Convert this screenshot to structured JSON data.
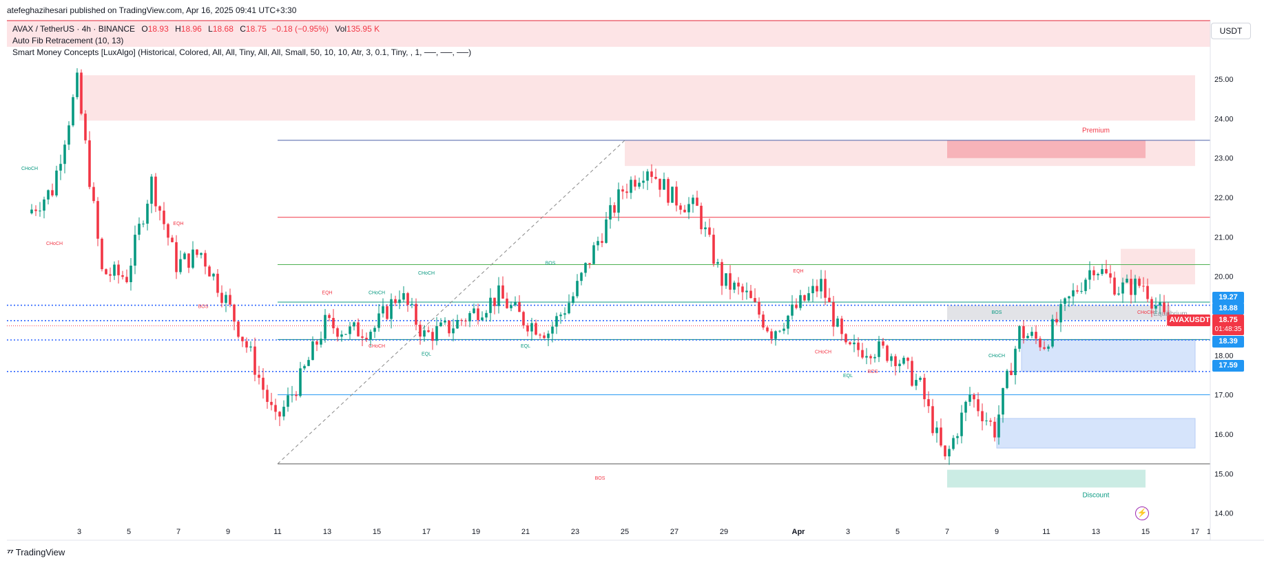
{
  "header": {
    "publisher": "atefeghazihesari published on TradingView.com, Apr 16, 2025 09:41 UTC+3:30"
  },
  "legend": {
    "symbol": "AVAX / TetherUS · 4h · BINANCE",
    "o_label": "O",
    "o_value": "18.93",
    "h_label": "H",
    "h_value": "18.96",
    "l_label": "L",
    "l_value": "18.68",
    "c_label": "C",
    "c_value": "18.75",
    "change": "−0.18 (−0.95%)",
    "vol_label": "Vol",
    "vol_value": "135.95 K",
    "indicator1": "Auto Fib Retracement (10, 13)",
    "indicator2": "Smart Money Concepts [LuxAlgo] (Historical, Colored, All, All, Tiny, All, All, Small, 50, 10, 10, Atr, 3, 0.1, Tiny, , 1, ──, ──, ──)"
  },
  "currency": "USDT",
  "price_tags": {
    "t1": "19.27",
    "t2": "18.88",
    "t3_symbol": "AVAXUSDT",
    "t3_price": "18.75",
    "t3_timer": "01:48:35",
    "t4": "18.39",
    "t5": "17.59"
  },
  "brand": {
    "name": "TradingView"
  },
  "colors": {
    "up": "#089981",
    "down": "#f23645",
    "blue_tag": "#2196f3",
    "accent": "#2962ff"
  },
  "chart_data": {
    "type": "candlestick",
    "title": "AVAX / TetherUS · 4h · BINANCE",
    "y_axis": {
      "ticks": [
        "25.00",
        "24.00",
        "23.00",
        "22.00",
        "21.00",
        "20.00",
        "19.00",
        "18.00",
        "17.00",
        "16.00",
        "15.00",
        "14.00"
      ],
      "range": [
        13.75,
        25.35
      ]
    },
    "x_axis": {
      "ticks": [
        "3",
        "5",
        "7",
        "9",
        "11",
        "13",
        "15",
        "17",
        "19",
        "21",
        "23",
        "25",
        "27",
        "29",
        "Apr",
        "3",
        "5",
        "7",
        "9",
        "11",
        "13",
        "15",
        "17",
        "1"
      ],
      "range": [
        "2025-03-01",
        "2025-04-17"
      ]
    },
    "close_path": [
      {
        "t": "2025-03-01",
        "p": 21.6
      },
      {
        "t": "2025-03-02",
        "p": 22.2
      },
      {
        "t": "2025-03-03",
        "p": 24.9
      },
      {
        "t": "2025-03-04",
        "p": 20.1
      },
      {
        "t": "2025-03-05",
        "p": 20.0
      },
      {
        "t": "2025-03-06",
        "p": 22.4
      },
      {
        "t": "2025-03-07",
        "p": 20.3
      },
      {
        "t": "2025-03-08",
        "p": 20.6
      },
      {
        "t": "2025-03-09",
        "p": 19.4
      },
      {
        "t": "2025-03-10",
        "p": 18.0
      },
      {
        "t": "2025-03-11",
        "p": 16.3
      },
      {
        "t": "2025-03-12",
        "p": 17.4
      },
      {
        "t": "2025-03-13",
        "p": 18.8
      },
      {
        "t": "2025-03-14",
        "p": 18.6
      },
      {
        "t": "2025-03-15",
        "p": 18.7
      },
      {
        "t": "2025-03-16",
        "p": 19.6
      },
      {
        "t": "2025-03-17",
        "p": 18.5
      },
      {
        "t": "2025-03-18",
        "p": 18.7
      },
      {
        "t": "2025-03-19",
        "p": 19.1
      },
      {
        "t": "2025-03-20",
        "p": 19.5
      },
      {
        "t": "2025-03-21",
        "p": 18.9
      },
      {
        "t": "2025-03-22",
        "p": 18.6
      },
      {
        "t": "2025-03-23",
        "p": 19.5
      },
      {
        "t": "2025-03-24",
        "p": 20.9
      },
      {
        "t": "2025-03-25",
        "p": 22.2
      },
      {
        "t": "2025-03-26",
        "p": 22.8
      },
      {
        "t": "2025-03-27",
        "p": 22.0
      },
      {
        "t": "2025-03-28",
        "p": 21.7
      },
      {
        "t": "2025-03-29",
        "p": 19.9
      },
      {
        "t": "2025-03-30",
        "p": 19.5
      },
      {
        "t": "2025-03-31",
        "p": 18.6
      },
      {
        "t": "2025-04-01",
        "p": 19.2
      },
      {
        "t": "2025-04-02",
        "p": 19.8
      },
      {
        "t": "2025-04-03",
        "p": 18.1
      },
      {
        "t": "2025-04-04",
        "p": 18.2
      },
      {
        "t": "2025-04-05",
        "p": 18.0
      },
      {
        "t": "2025-04-06",
        "p": 17.2
      },
      {
        "t": "2025-04-07",
        "p": 15.3
      },
      {
        "t": "2025-04-08",
        "p": 17.0
      },
      {
        "t": "2025-04-09",
        "p": 16.1
      },
      {
        "t": "2025-04-10",
        "p": 18.6
      },
      {
        "t": "2025-04-11",
        "p": 18.3
      },
      {
        "t": "2025-04-12",
        "p": 19.4
      },
      {
        "t": "2025-04-13",
        "p": 20.3
      },
      {
        "t": "2025-04-14",
        "p": 19.7
      },
      {
        "t": "2025-04-15",
        "p": 19.8
      },
      {
        "t": "2025-04-16",
        "p": 18.75
      }
    ],
    "zones": [
      {
        "type": "supply",
        "from": "2025-03-03",
        "to": "2025-04-17",
        "low": 23.95,
        "high": 25.1
      },
      {
        "type": "supply",
        "from": "2025-03-25",
        "to": "2025-04-17",
        "low": 22.8,
        "high": 23.45
      },
      {
        "type": "supply-strong",
        "from": "2025-04-07",
        "to": "2025-04-15",
        "low": 23.0,
        "high": 23.45
      },
      {
        "type": "supply",
        "from": "2025-04-14",
        "to": "2025-04-17",
        "low": 19.8,
        "high": 20.7
      },
      {
        "type": "equilibrium",
        "from": "2025-04-07",
        "to": "2025-04-16",
        "low": 18.9,
        "high": 19.27
      },
      {
        "type": "demand",
        "from": "2025-04-10",
        "to": "2025-04-17",
        "low": 17.59,
        "high": 18.39
      },
      {
        "type": "demand",
        "from": "2025-04-09",
        "to": "2025-04-17",
        "low": 15.65,
        "high": 16.4
      },
      {
        "type": "discount",
        "from": "2025-04-07",
        "to": "2025-04-15",
        "low": 14.65,
        "high": 15.1
      }
    ],
    "levels": [
      {
        "name": "fib-top",
        "price": 23.45,
        "color": "#4a5fa8"
      },
      {
        "name": "fib-1",
        "price": 21.5,
        "color": "#f23645"
      },
      {
        "name": "fib-2",
        "price": 20.3,
        "color": "#4caf50"
      },
      {
        "name": "fib-3",
        "price": 19.35,
        "color": "#089981"
      },
      {
        "name": "fib-4",
        "price": 18.4,
        "color": "#00897b"
      },
      {
        "name": "fib-5",
        "price": 17.0,
        "color": "#2196f3"
      },
      {
        "name": "fib-bottom",
        "price": 15.25,
        "color": "#555555"
      }
    ],
    "dotted_levels": [
      19.27,
      18.88,
      18.39,
      17.59
    ],
    "labels": [
      {
        "text": "Premium",
        "t": "2025-04-13",
        "p": 23.65,
        "color": "#f23645"
      },
      {
        "text": "Discount",
        "t": "2025-04-13",
        "p": 14.4,
        "color": "#089981"
      },
      {
        "text": "Equilibrium",
        "t": "2025-04-16",
        "p": 19.0,
        "color": "#9598a1"
      },
      {
        "text": "BOS",
        "t": "2025-03-24",
        "p": 14.85,
        "color": "#f23645"
      },
      {
        "text": "BOS",
        "t": "2025-03-22",
        "p": 20.3,
        "color": "#089981"
      },
      {
        "text": "BOS",
        "t": "2025-04-09",
        "p": 19.05,
        "color": "#089981"
      },
      {
        "text": "BOS",
        "t": "2025-04-04",
        "p": 17.55,
        "color": "#f23645"
      },
      {
        "text": "BOS",
        "t": "2025-03-08",
        "p": 19.2,
        "color": "#f23645"
      },
      {
        "text": "CHoCH",
        "t": "2025-03-01",
        "p": 22.7,
        "color": "#089981"
      },
      {
        "text": "CHoCH",
        "t": "2025-03-02",
        "p": 20.8,
        "color": "#f23645"
      },
      {
        "text": "CHoCH",
        "t": "2025-03-17",
        "p": 20.05,
        "color": "#089981"
      },
      {
        "text": "CHoCH",
        "t": "2025-03-15",
        "p": 19.55,
        "color": "#089981"
      },
      {
        "text": "CHoCH",
        "t": "2025-03-15",
        "p": 18.2,
        "color": "#f23645"
      },
      {
        "text": "CHoCH",
        "t": "2025-04-02",
        "p": 18.05,
        "color": "#f23645"
      },
      {
        "text": "CHoCH",
        "t": "2025-04-09",
        "p": 17.95,
        "color": "#089981"
      },
      {
        "text": "CHoCH",
        "t": "2025-04-15",
        "p": 19.05,
        "color": "#f23645"
      },
      {
        "text": "EQH",
        "t": "2025-03-07",
        "p": 21.3,
        "color": "#f23645"
      },
      {
        "text": "EQH",
        "t": "2025-03-13",
        "p": 19.55,
        "color": "#f23645"
      },
      {
        "text": "EQH",
        "t": "2025-04-01",
        "p": 20.1,
        "color": "#f23645"
      },
      {
        "text": "EQL",
        "t": "2025-03-17",
        "p": 18.0,
        "color": "#089981"
      },
      {
        "text": "EQL",
        "t": "2025-03-21",
        "p": 18.2,
        "color": "#089981"
      },
      {
        "text": "EQL",
        "t": "2025-04-03",
        "p": 17.45,
        "color": "#089981"
      }
    ]
  }
}
